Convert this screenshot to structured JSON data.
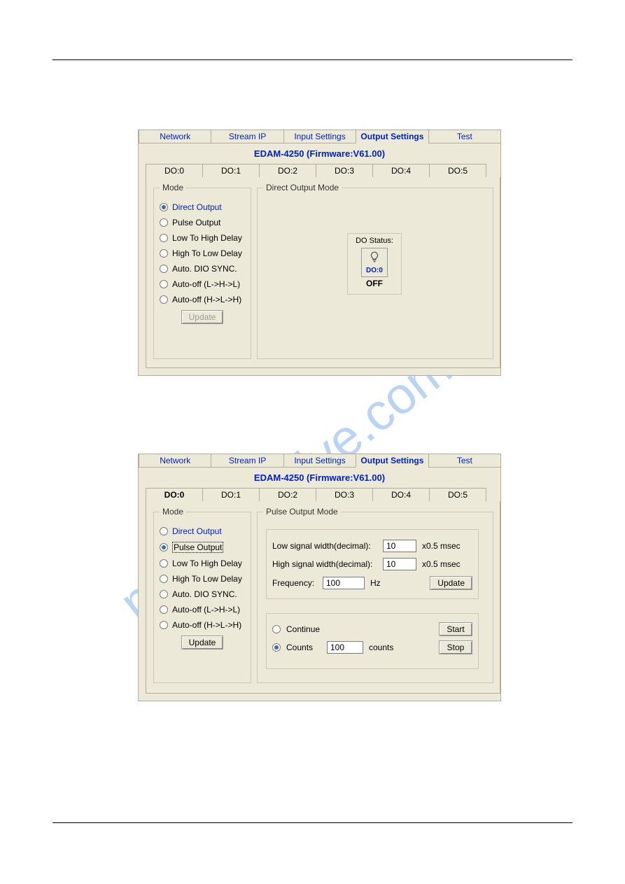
{
  "watermark_text": "manualshive.com",
  "panel1": {
    "main_tabs": [
      "Network",
      "Stream IP",
      "Input Settings",
      "Output Settings",
      "Test"
    ],
    "main_active": "Output Settings",
    "title": "EDAM-4250 (Firmware:V61.00)",
    "do_tabs": [
      "DO:0",
      "DO:1",
      "DO:2",
      "DO:3",
      "DO:4",
      "DO:5"
    ],
    "do_active": "DO:0",
    "mode_legend": "Mode",
    "modes": [
      "Direct Output",
      "Pulse Output",
      "Low To High Delay",
      "High To Low Delay",
      "Auto. DIO SYNC.",
      "Auto-off (L->H->L)",
      "Auto-off (H->L->H)"
    ],
    "mode_selected": "Direct Output",
    "update_label": "Update",
    "right_legend": "Direct Output Mode",
    "status_legend": "DO Status:",
    "status_do": "DO:0",
    "status_state": "OFF"
  },
  "panel2": {
    "main_tabs": [
      "Network",
      "Stream IP",
      "Input Settings",
      "Output Settings",
      "Test"
    ],
    "main_active": "Output Settings",
    "title": "EDAM-4250 (Firmware:V61.00)",
    "do_tabs": [
      "DO:0",
      "DO:1",
      "DO:2",
      "DO:3",
      "DO:4",
      "DO:5"
    ],
    "do_active": "DO:0",
    "mode_legend": "Mode",
    "modes": [
      "Direct Output",
      "Pulse Output",
      "Low To High Delay",
      "High To Low Delay",
      "Auto. DIO SYNC.",
      "Auto-off (L->H->L)",
      "Auto-off (H->L->H)"
    ],
    "mode_selected": "Pulse Output",
    "update_label": "Update",
    "right_legend": "Pulse Output  Mode",
    "params": {
      "low_label": "Low signal width(decimal):",
      "low_value": "10",
      "low_unit": "x0.5 msec",
      "high_label": "High signal width(decimal):",
      "high_value": "10",
      "high_unit": "x0.5 msec",
      "freq_label": "Frequency:",
      "freq_value": "100",
      "freq_unit": "Hz",
      "update_label": "Update"
    },
    "run": {
      "continue_label": "Continue",
      "counts_label": "Counts",
      "counts_value": "100",
      "counts_unit": "counts",
      "run_selected": "Counts",
      "start_label": "Start",
      "stop_label": "Stop"
    }
  }
}
